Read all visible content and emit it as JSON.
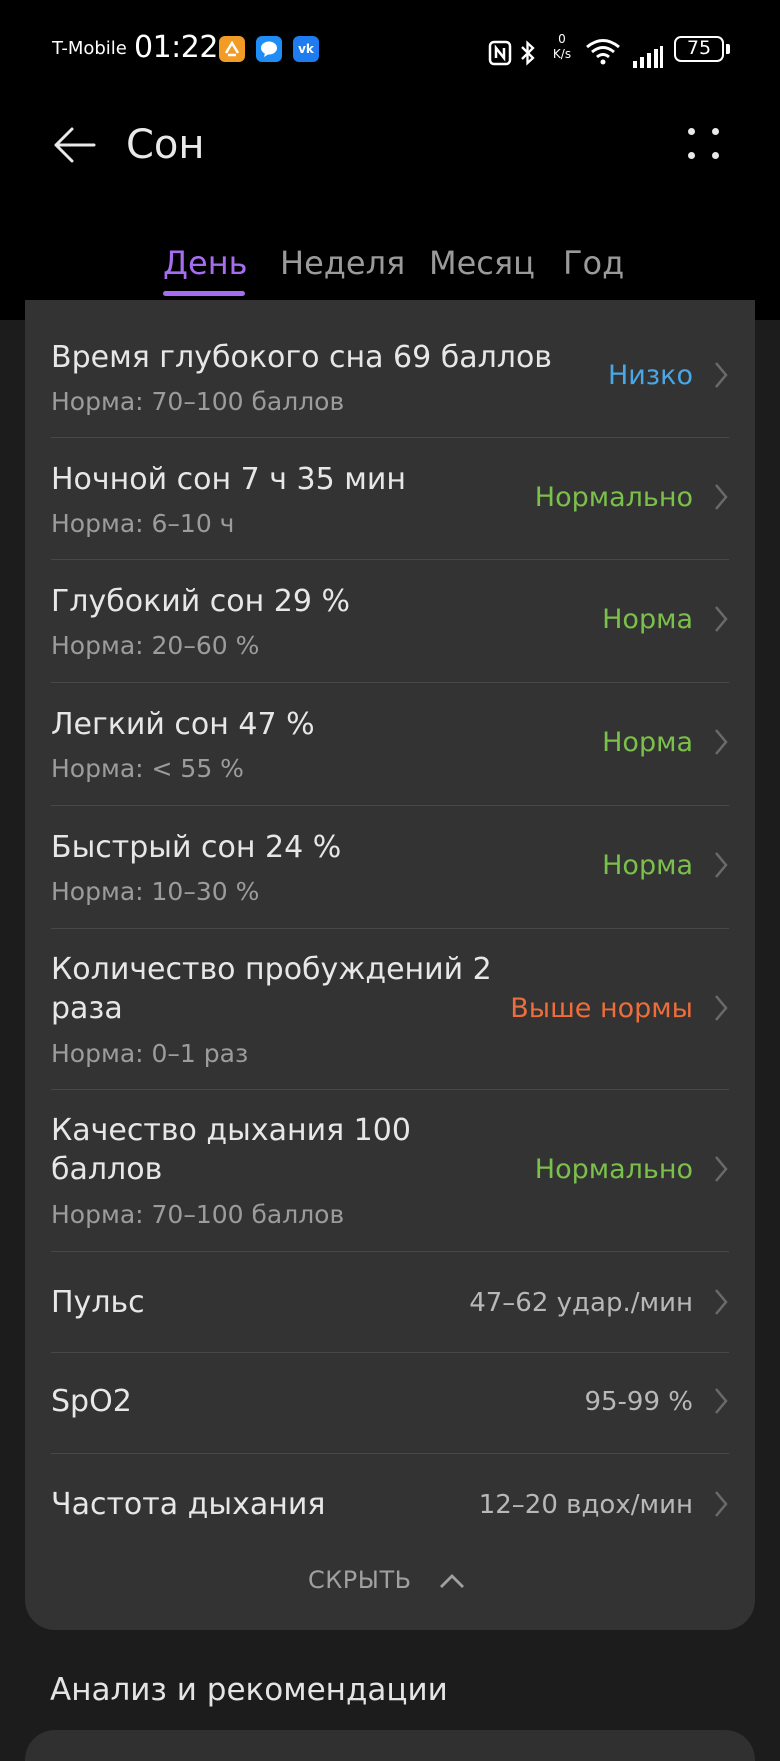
{
  "status_bar": {
    "carrier": "T-Mobile",
    "time": "01:22",
    "net_speed_value": "0",
    "net_speed_unit": "K/s",
    "battery": "75"
  },
  "header": {
    "title": "Сон"
  },
  "tabs": [
    {
      "label": "День",
      "active": true
    },
    {
      "label": "Неделя",
      "active": false
    },
    {
      "label": "Месяц",
      "active": false
    },
    {
      "label": "Год",
      "active": false
    }
  ],
  "rows": [
    {
      "title": "Время глубокого сна  69 баллов",
      "norm": "Норма: 70–100 баллов",
      "status": "Низко",
      "status_color": "#4aa7e6"
    },
    {
      "title": "Ночной сон  7 ч 35 мин",
      "norm": "Норма: 6–10 ч",
      "status": "Нормально",
      "status_color": "#7ac04a"
    },
    {
      "title": "Глубокий сон  29 %",
      "norm": "Норма: 20–60 %",
      "status": "Норма",
      "status_color": "#7ac04a"
    },
    {
      "title": "Легкий сон  47 %",
      "norm": "Норма: < 55 %",
      "status": "Норма",
      "status_color": "#7ac04a"
    },
    {
      "title": "Быстрый сон  24 %",
      "norm": "Норма: 10–30 %",
      "status": "Норма",
      "status_color": "#7ac04a"
    },
    {
      "title_line1": "Количество пробуждений  2",
      "title_line2": "раза",
      "norm": "Норма: 0–1 раз",
      "status": "Выше нормы",
      "status_color": "#ee6d3a"
    },
    {
      "title_line1": "Качество дыхания  100",
      "title_line2": "баллов",
      "norm": "Норма: 70–100 баллов",
      "status": "Нормально",
      "status_color": "#7ac04a"
    },
    {
      "title": "Пульс",
      "value": "47–62 удар./мин"
    },
    {
      "title": "SpO2",
      "value": "95-99 %"
    },
    {
      "title": "Частота дыхания",
      "value": "12–20 вдох/мин"
    }
  ],
  "hide_label": "СКРЫТЬ",
  "section_title": "Анализ и рекомендации",
  "accent_color": "#a66df0"
}
